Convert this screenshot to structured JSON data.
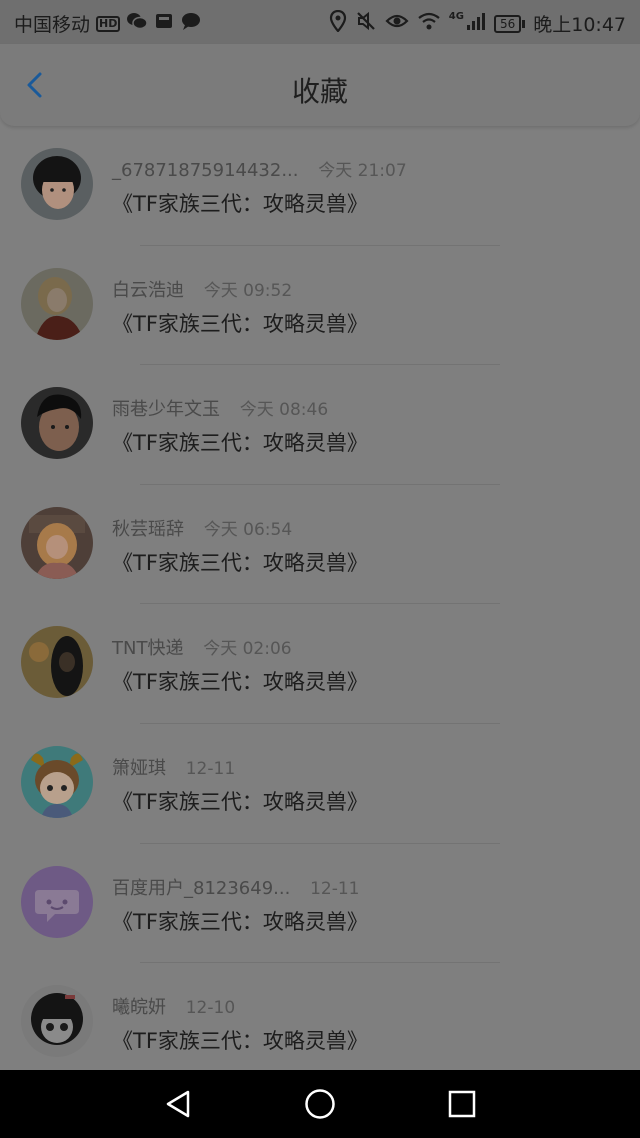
{
  "status_bar": {
    "carrier": "中国移动",
    "hd_badge": "HD",
    "network": "4G",
    "battery": "56",
    "time": "晚上10:47",
    "left_icons": [
      "wechat-icon",
      "gallery-icon",
      "message-icon"
    ],
    "right_icons": [
      "location-icon",
      "mute-icon",
      "eye-icon",
      "wifi-icon",
      "signal-icon"
    ]
  },
  "header": {
    "title": "收藏",
    "back_icon": "chevron-left-icon",
    "accent": "#1a5a9a"
  },
  "items": [
    {
      "name": "_67871875914432...",
      "time": "今天 21:07",
      "message": "《TF家族三代：攻略灵兽》",
      "avatar": "portrait-girl"
    },
    {
      "name": "白云浩迪",
      "time": "今天 09:52",
      "message": "《TF家族三代：攻略灵兽》",
      "avatar": "blonde-girl"
    },
    {
      "name": "雨巷少年文玉",
      "time": "今天 08:46",
      "message": "《TF家族三代：攻略灵兽》",
      "avatar": "portrait-boy"
    },
    {
      "name": "秋芸瑶辞",
      "time": "今天 06:54",
      "message": "《TF家族三代：攻略灵兽》",
      "avatar": "anime-girl"
    },
    {
      "name": "TNT快递",
      "time": "今天 02:06",
      "message": "《TF家族三代：攻略灵兽》",
      "avatar": "dark-portrait"
    },
    {
      "name": "箫娅琪",
      "time": "12-11",
      "message": "《TF家族三代：攻略灵兽》",
      "avatar": "cartoon-boy"
    },
    {
      "name": "百度用户_8123649...",
      "time": "12-11",
      "message": "《TF家族三代：攻略灵兽》",
      "avatar": "chat-bubble-default"
    },
    {
      "name": "曦皖妍",
      "time": "12-10",
      "message": "《TF家族三代：攻略灵兽》",
      "avatar": "anime-girl-bw"
    }
  ],
  "nav_bar": {
    "buttons": [
      "back-triangle-icon",
      "home-circle-icon",
      "recents-square-icon"
    ]
  }
}
